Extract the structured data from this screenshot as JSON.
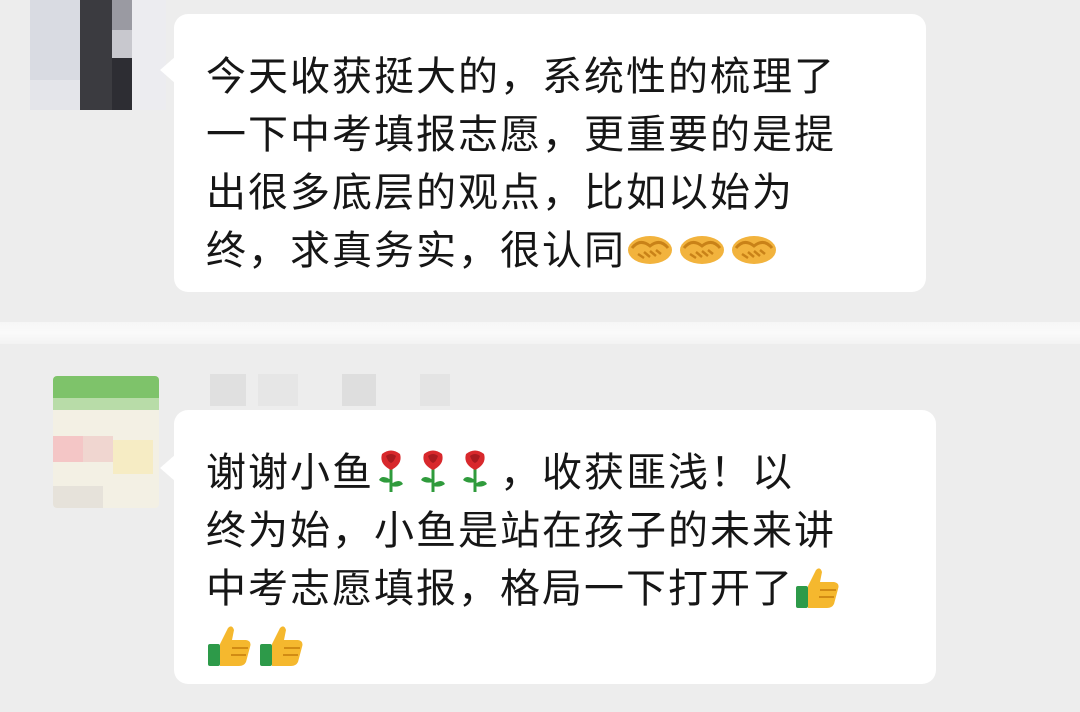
{
  "messages": [
    {
      "lines": [
        {
          "text": "今天收获挺大的，系统性的梳理了"
        },
        {
          "text": "一下中考填报志愿，更重要的是提"
        },
        {
          "text": "出很多底层的观点，比如以始为"
        },
        {
          "text": "终，求真务实，很认同",
          "emoji_after": [
            "handshake-icon",
            "handshake-icon",
            "handshake-icon"
          ]
        }
      ]
    },
    {
      "lines": [
        {
          "text_before": "谢谢小鱼",
          "emoji_mid": [
            "rose-icon",
            "rose-icon",
            "rose-icon"
          ],
          "text": "，收获匪浅！以"
        },
        {
          "text": "终为始，小鱼是站在孩子的未来讲"
        },
        {
          "text": "中考志愿填报，格局一下打开了",
          "emoji_after": [
            "thumbs-up-icon"
          ]
        },
        {
          "text": "",
          "emoji_after": [
            "thumbs-up-icon",
            "thumbs-up-icon"
          ]
        }
      ]
    }
  ],
  "colors": {
    "background": "#ededed",
    "bubble": "#ffffff",
    "text": "#161616",
    "handshake": "#f2b33d",
    "rose": "#d8282c",
    "leaf": "#2f9b3c",
    "thumb": "#f5b82e",
    "cuff": "#2d9a49"
  }
}
